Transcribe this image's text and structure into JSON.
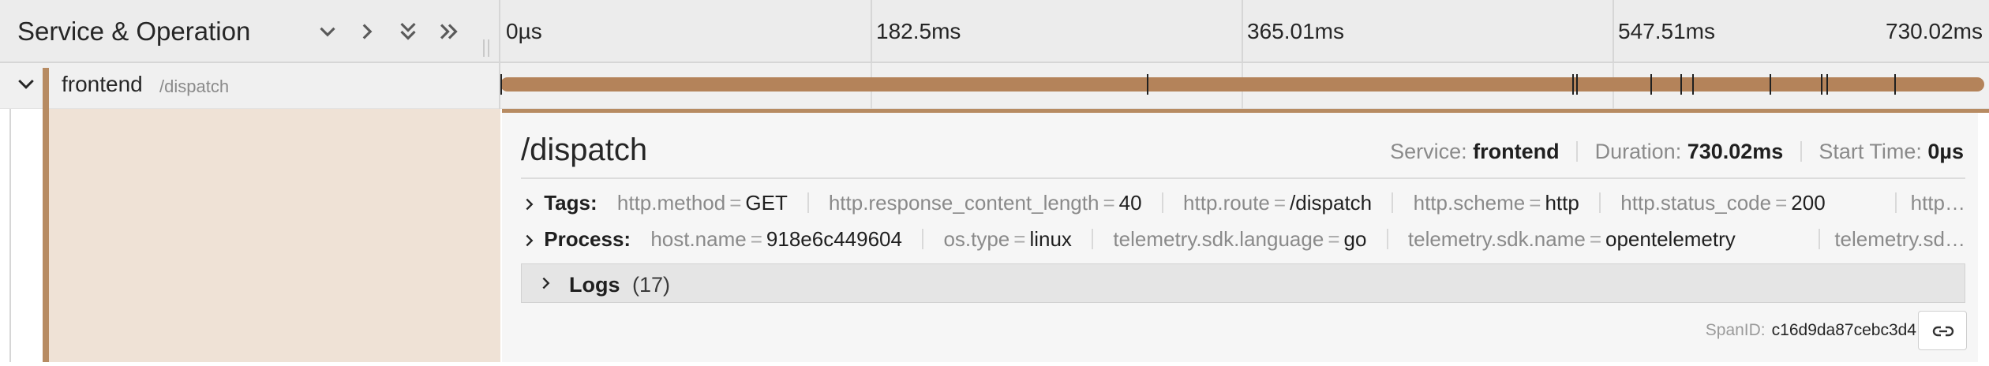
{
  "header": {
    "title": "Service & Operation",
    "buttons": [
      "collapse-one-icon",
      "expand-one-icon",
      "collapse-all-icon",
      "expand-all-icon"
    ],
    "ticks": [
      "0µs",
      "182.5ms",
      "365.01ms",
      "547.51ms",
      "730.02ms"
    ]
  },
  "span": {
    "service": "frontend",
    "operation": "/dispatch",
    "color": "#b78b62"
  },
  "detail": {
    "title": "/dispatch",
    "meta": {
      "service_label": "Service:",
      "service_value": "frontend",
      "duration_label": "Duration:",
      "duration_value": "730.02ms",
      "start_label": "Start Time:",
      "start_value": "0µs"
    },
    "tags": {
      "label": "Tags:",
      "items": [
        {
          "key": "http.method",
          "value": "GET"
        },
        {
          "key": "http.response_content_length",
          "value": "40"
        },
        {
          "key": "http.route",
          "value": "/dispatch"
        },
        {
          "key": "http.scheme",
          "value": "http"
        },
        {
          "key": "http.status_code",
          "value": "200"
        }
      ],
      "truncated": "http…"
    },
    "process": {
      "label": "Process:",
      "items": [
        {
          "key": "host.name",
          "value": "918e6c449604"
        },
        {
          "key": "os.type",
          "value": "linux"
        },
        {
          "key": "telemetry.sdk.language",
          "value": "go"
        },
        {
          "key": "telemetry.sdk.name",
          "value": "opentelemetry"
        }
      ],
      "truncated": "telemetry.sd…"
    },
    "logs": {
      "label": "Logs",
      "count": "(17)"
    },
    "span_id": {
      "label": "SpanID:",
      "value": "c16d9da87cebc3d4"
    }
  }
}
